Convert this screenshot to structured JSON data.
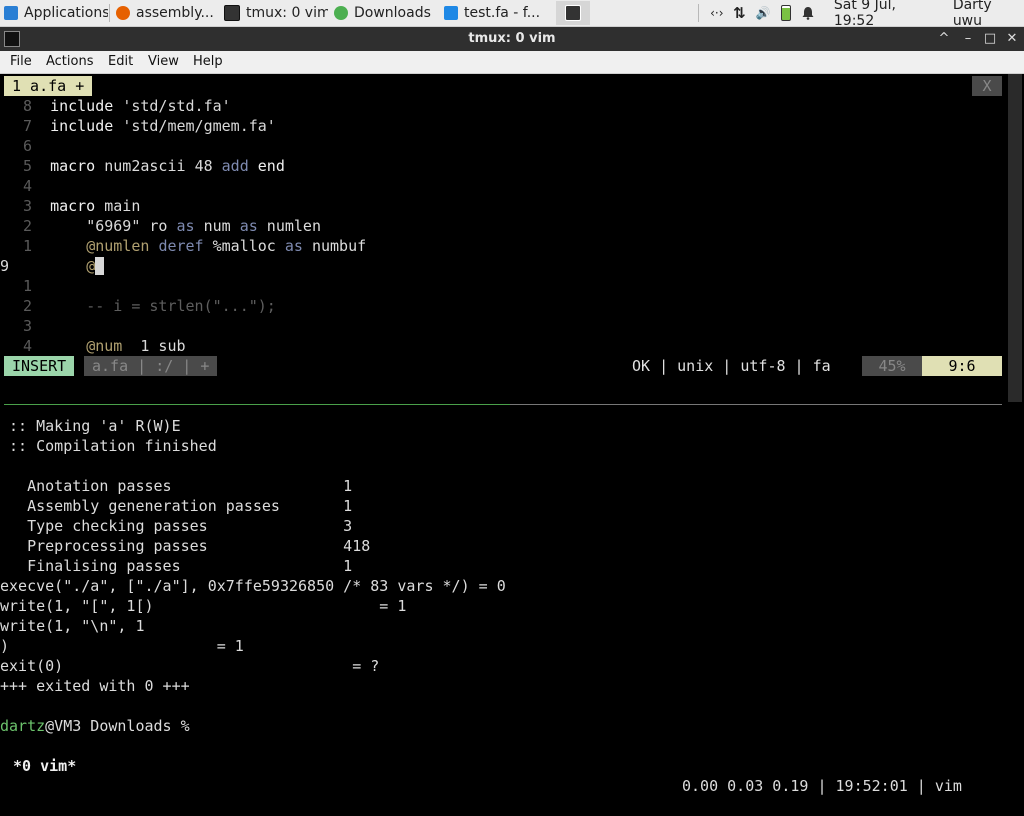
{
  "panel": {
    "tasks": [
      {
        "label": "Applications",
        "icon": "xfce-icon",
        "color": "#2a7fd4"
      },
      {
        "label": "assembly...",
        "icon": "firefox-icon",
        "color": "#e66000"
      },
      {
        "label": "tmux: 0 vim",
        "icon": "terminal-icon",
        "color": "#333333"
      },
      {
        "label": "Downloads",
        "icon": "download-icon",
        "color": "#4caf50"
      },
      {
        "label": "test.fa - f...",
        "icon": "vscode-icon",
        "color": "#1e88e5"
      }
    ],
    "active_icon": "terminal-icon",
    "tray": {
      "network_glyph": "‹·›",
      "transfer_glyph": "⇅",
      "volume_glyph": "🔊",
      "clock": "Sat  9 Jul, 19:52",
      "user": "Darty uwu"
    }
  },
  "window": {
    "title": "tmux: 0 vim",
    "icon": "terminal-icon",
    "controls": [
      "^",
      "–",
      "□",
      "✕"
    ]
  },
  "menubar": [
    "File",
    "Actions",
    "Edit",
    "View",
    "Help"
  ],
  "vim": {
    "tab_label": "1 a.fa +",
    "tab_close": "X",
    "lines": [
      {
        "num": "8",
        "text": "include 'std/std.fa'"
      },
      {
        "num": "7",
        "text": "include 'std/mem/gmem.fa'"
      },
      {
        "num": "6",
        "text": ""
      },
      {
        "num": "5",
        "text": "macro num2ascii 48 add end"
      },
      {
        "num": "4",
        "text": ""
      },
      {
        "num": "3",
        "text": "macro main"
      },
      {
        "num": "2",
        "text": "    \"6969\" ro as num as numlen"
      },
      {
        "num": "1",
        "text": "    @numlen deref %malloc as numbuf"
      },
      {
        "num": "9",
        "text": "    @"
      },
      {
        "num": "1",
        "text": ""
      },
      {
        "num": "2",
        "text": "    -- i = strlen(\"...\");"
      },
      {
        "num": "3",
        "text": ""
      },
      {
        "num": "4",
        "text": "    @num  1 sub"
      }
    ],
    "status": {
      "mode": "INSERT",
      "file": "a.fa | :/ | +",
      "right": "OK | unix | utf-8 | fa",
      "percent": "45%",
      "position": "9:6"
    }
  },
  "shell": {
    "lines": [
      " :: Making 'a' R(W)E",
      " :: Compilation finished",
      "",
      "   Anotation passes                   1",
      "   Assembly geneneration passes       1",
      "   Type checking passes               3",
      "   Preprocessing passes               418",
      "   Finalising passes                  1",
      "execve(\"./a\", [\"./a\"], 0x7ffe59326850 /* 83 vars */) = 0",
      "write(1, \"[\", 1[)                         = 1",
      "write(1, \"\\n\", 1",
      ")                       = 1",
      "exit(0)                                = ?",
      "+++ exited with 0 +++",
      ""
    ],
    "prompt_user": "dartz",
    "prompt_rest": "@VM3 Downloads %"
  },
  "tmux": {
    "window": " *0 vim*",
    "right": "0.00 0.03 0.19 | 19:52:01 | vim"
  }
}
